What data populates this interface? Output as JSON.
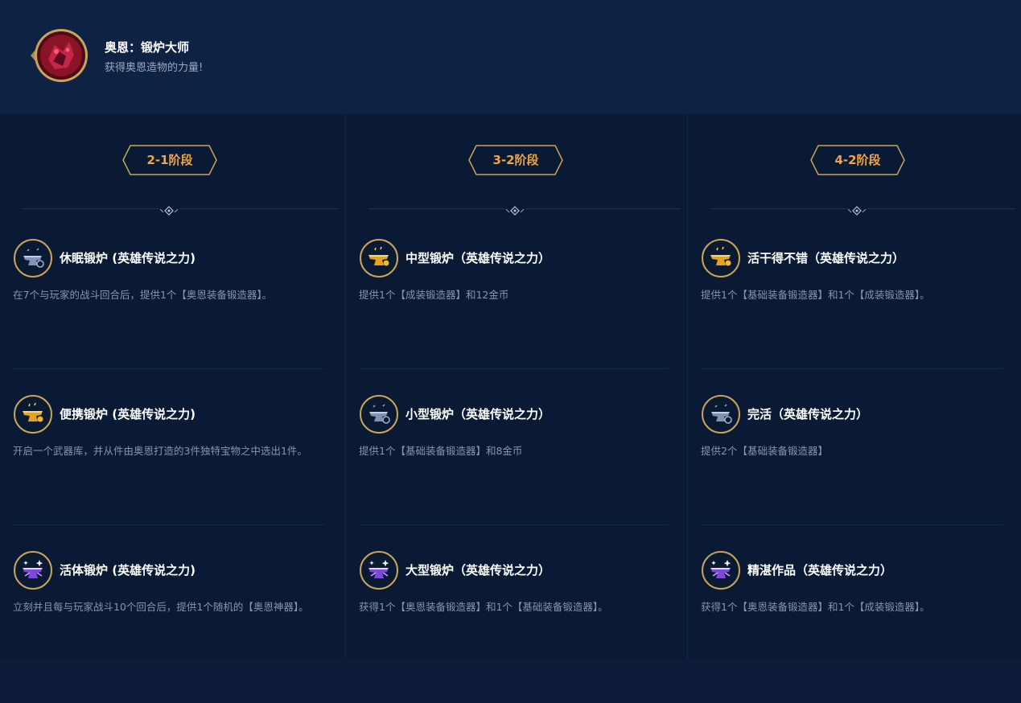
{
  "header": {
    "title": "奥恩：锻炉大师",
    "subtitle": "获得奥恩造物的力量!"
  },
  "columns": [
    {
      "stage": "2-1阶段",
      "augments": [
        {
          "name": "休眠锻炉 (英雄传说之力)",
          "desc": "在7个与玩家的战斗回合后，提供1个【奥恩装备锻造器】。",
          "tier": "silver"
        },
        {
          "name": "便携锻炉 (英雄传说之力)",
          "desc": "开启一个武器库，并从件由奥恩打造的3件独特宝物之中选出1件。",
          "tier": "gold"
        },
        {
          "name": "活体锻炉 (英雄传说之力)",
          "desc": "立刻并且每与玩家战斗10个回合后，提供1个随机的【奥恩神器】。",
          "tier": "prismatic"
        }
      ]
    },
    {
      "stage": "3-2阶段",
      "augments": [
        {
          "name": "中型锻炉（英雄传说之力）",
          "desc": "提供1个【成装锻造器】和12金币",
          "tier": "gold"
        },
        {
          "name": "小型锻炉（英雄传说之力）",
          "desc": "提供1个【基础装备锻造器】和8金币",
          "tier": "silver"
        },
        {
          "name": "大型锻炉（英雄传说之力）",
          "desc": "获得1个【奥恩装备锻造器】和1个【基础装备锻造器】。",
          "tier": "prismatic"
        }
      ]
    },
    {
      "stage": "4-2阶段",
      "augments": [
        {
          "name": "活干得不错（英雄传说之力）",
          "desc": "提供1个【基础装备锻造器】和1个【成装锻造器】。",
          "tier": "gold"
        },
        {
          "name": "完活（英雄传说之力）",
          "desc": "提供2个【基础装备锻造器】",
          "tier": "silver"
        },
        {
          "name": "精湛作品（英雄传说之力）",
          "desc": "获得1个【奥恩装备锻造器】和1个【成装锻造器】。",
          "tier": "prismatic"
        }
      ]
    }
  ],
  "icons": {
    "avatar": "ornn-champion-avatar",
    "augment": "anvil-icon",
    "ornament": "diamond-ornament-icon"
  },
  "colors": {
    "background": "#0a1a35",
    "header": "#0e2244",
    "accent": "#f0a444",
    "gold_frame": "#c9a45a",
    "desc": "#8795ad"
  }
}
